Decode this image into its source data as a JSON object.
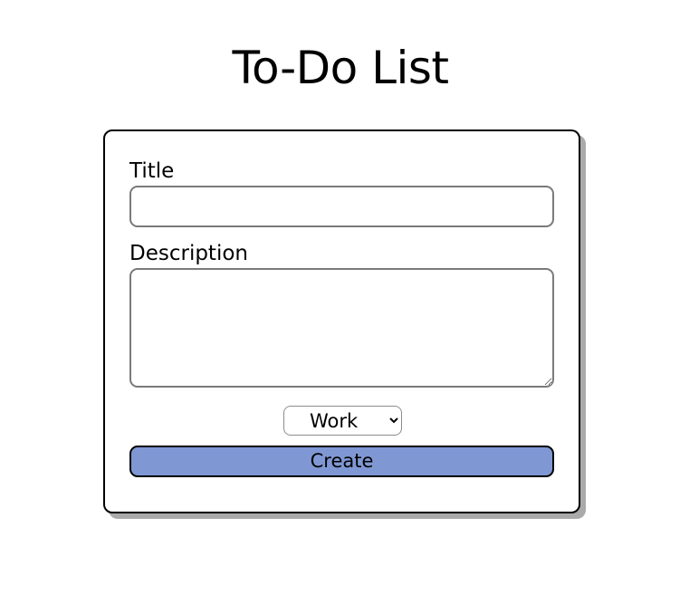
{
  "header": {
    "title": "To-Do List"
  },
  "form": {
    "title_label": "Title",
    "title_value": "",
    "title_placeholder": "",
    "description_label": "Description",
    "description_value": "",
    "description_placeholder": "",
    "category": {
      "selected": "Work",
      "options": [
        "Work"
      ]
    },
    "create_label": "Create"
  },
  "colors": {
    "button_fill": "#7f98d4",
    "card_shadow": "#aaaaaa",
    "input_border": "#7a7a7a"
  }
}
